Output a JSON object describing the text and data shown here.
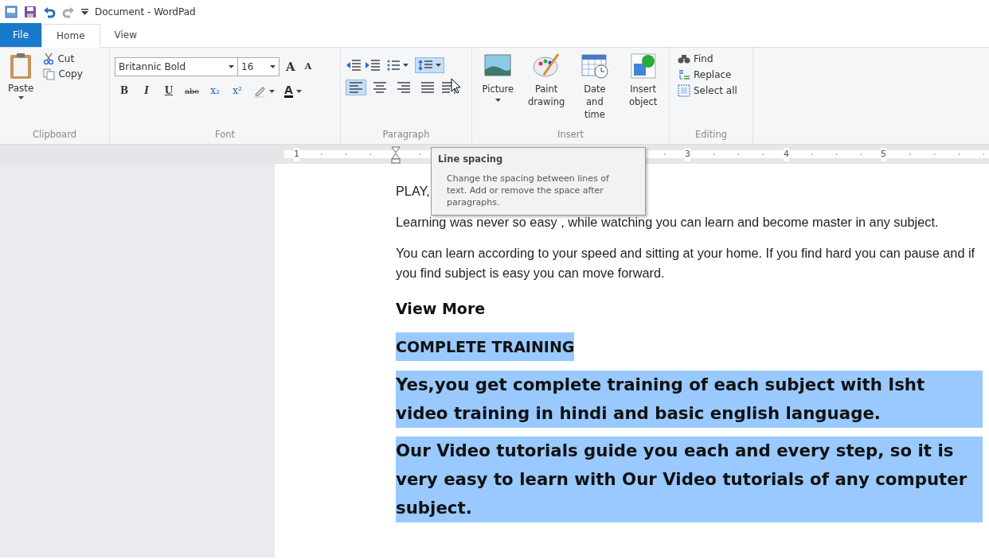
{
  "window": {
    "title": "Document - WordPad"
  },
  "tabs": [
    {
      "label": "File",
      "kind": "file",
      "selected": false
    },
    {
      "label": "Home",
      "kind": "tab",
      "selected": true
    },
    {
      "label": "View",
      "kind": "tab",
      "selected": false
    }
  ],
  "ribbon": {
    "clipboard": {
      "label": "Clipboard",
      "paste": "Paste",
      "cut": "Cut",
      "copy": "Copy"
    },
    "font": {
      "label": "Font",
      "font_name": "Britannic Bold",
      "font_size": "16",
      "size_buttons": [
        {
          "label": "A",
          "kind": "grow"
        },
        {
          "label": "A",
          "kind": "shrink"
        }
      ],
      "format_buttons": [
        {
          "label": "B",
          "kind": "bold"
        },
        {
          "label": "I",
          "kind": "italic"
        },
        {
          "label": "U",
          "kind": "underline"
        },
        {
          "label": "abc",
          "kind": "strike"
        },
        {
          "label": "x₂",
          "kind": "sub"
        },
        {
          "label": "x²",
          "kind": "sup"
        }
      ],
      "font_color": "A"
    },
    "paragraph": {
      "label": "Paragraph",
      "line_spacing": {
        "hovered": true
      },
      "alignments": [
        {
          "kind": "left",
          "selected": true
        },
        {
          "kind": "center",
          "selected": false
        },
        {
          "kind": "right",
          "selected": false
        },
        {
          "kind": "justify",
          "selected": false
        }
      ]
    },
    "insert": {
      "label": "Insert",
      "items": [
        {
          "label": "Picture",
          "kind": "picture",
          "dropdown": true
        },
        {
          "label": "Paint drawing",
          "kind": "paint",
          "dropdown": false
        },
        {
          "label": "Date and time",
          "kind": "date",
          "dropdown": false
        },
        {
          "label": "Insert object",
          "kind": "object",
          "dropdown": false
        }
      ]
    },
    "editing": {
      "label": "Editing",
      "items": [
        {
          "label": "Find",
          "kind": "find"
        },
        {
          "label": "Replace",
          "kind": "replace"
        },
        {
          "label": "Select all",
          "kind": "select-all"
        }
      ]
    }
  },
  "ruler": {
    "labels": [
      "1",
      "3",
      "4",
      "5"
    ]
  },
  "tooltip": {
    "title": "Line spacing",
    "text": "Change the spacing between lines of text. Add or remove the space after paragraphs."
  },
  "document": {
    "paragraphs": [
      {
        "text": "PLAY,",
        "kind": "body",
        "selected": false
      },
      {
        "text": "Learning was never so easy , while watching you can learn and become master in any subject.",
        "kind": "body",
        "selected": false
      },
      {
        "text": "You can learn according to your speed and sitting at your home. If you find hard you can pause and if you find subject is easy you can move forward.",
        "kind": "body",
        "selected": false
      },
      {
        "text": "View More",
        "kind": "heading",
        "selected": false
      },
      {
        "text": "COMPLETE TRAINING",
        "kind": "heading",
        "selected": true
      },
      {
        "text": "Yes,you get complete training of each subject with Isht video training in hindi and basic english language.",
        "kind": "big",
        "selected": true
      },
      {
        "text": "Our Video tutorials guide you each and every step, so it is very easy to learn with Our Video tutorials of any computer subject.",
        "kind": "big",
        "selected": true
      }
    ]
  }
}
